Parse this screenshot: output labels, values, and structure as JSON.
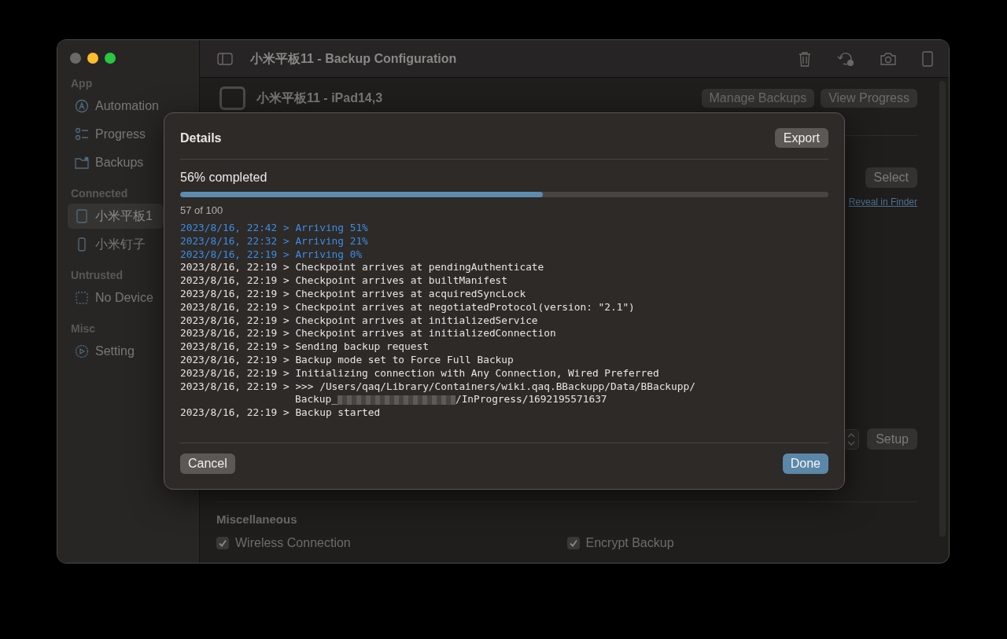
{
  "window": {
    "title": "小米平板11 - Backup Configuration"
  },
  "sidebar": {
    "sections": [
      {
        "title": "App",
        "items": [
          {
            "label": "Automation",
            "kind": "automation",
            "selected": false
          },
          {
            "label": "Progress",
            "kind": "progress",
            "selected": false
          },
          {
            "label": "Backups",
            "kind": "backups",
            "selected": false
          }
        ]
      },
      {
        "title": "Connected",
        "items": [
          {
            "label": "小米平板1",
            "kind": "tablet",
            "selected": true
          },
          {
            "label": "小米钉子",
            "kind": "phone",
            "selected": false
          }
        ]
      },
      {
        "title": "Untrusted",
        "items": [
          {
            "label": "No Device",
            "kind": "empty",
            "selected": false
          }
        ]
      },
      {
        "title": "Misc",
        "items": [
          {
            "label": "Setting",
            "kind": "gear",
            "selected": false
          }
        ]
      }
    ]
  },
  "device": {
    "name": "小米平板11 - iPad14,3",
    "buttons": [
      "Manage Backups",
      "View Progress"
    ]
  },
  "select_button": "Select",
  "reveal_link": "Reveal in Finder",
  "setup_button": "Setup",
  "miscellaneous": {
    "title": "Miscellaneous",
    "options": [
      {
        "label": "Wireless Connection",
        "checked": true
      },
      {
        "label": "Encrypt Backup",
        "checked": true
      }
    ]
  },
  "dialog": {
    "title": "Details",
    "export_button": "Export",
    "progress_text": "56% completed",
    "level": 0.56,
    "count": "57 of 100",
    "log": [
      {
        "kind": "progress",
        "time": "2023/8/16, 22:42",
        "prompt": ">",
        "message": "Arriving 51%"
      },
      {
        "kind": "progress",
        "time": "2023/8/16, 22:32",
        "prompt": ">",
        "message": "Arriving 21%"
      },
      {
        "kind": "progress",
        "time": "2023/8/16, 22:19",
        "prompt": ">",
        "message": "Arriving 0%"
      },
      {
        "kind": "event",
        "time": "2023/8/16, 22:19",
        "prompt": ">",
        "message": "Checkpoint arrives at pendingAuthenticate"
      },
      {
        "kind": "event",
        "time": "2023/8/16, 22:19",
        "prompt": ">",
        "message": "Checkpoint arrives at builtManifest"
      },
      {
        "kind": "event",
        "time": "2023/8/16, 22:19",
        "prompt": ">",
        "message": "Checkpoint arrives at acquiredSyncLock"
      },
      {
        "kind": "event",
        "time": "2023/8/16, 22:19",
        "prompt": ">",
        "message": "Checkpoint arrives at negotiatedProtocol(version: \"2.1\")"
      },
      {
        "kind": "event",
        "time": "2023/8/16, 22:19",
        "prompt": ">",
        "message": "Checkpoint arrives at initializedService"
      },
      {
        "kind": "event",
        "time": "2023/8/16, 22:19",
        "prompt": ">",
        "message": "Checkpoint arrives at initializedConnection"
      },
      {
        "kind": "event",
        "time": "2023/8/16, 22:19",
        "prompt": ">",
        "message": "Sending backup request"
      },
      {
        "kind": "event",
        "time": "2023/8/16, 22:19",
        "prompt": ">",
        "message": "Backup mode set to Force Full Backup"
      },
      {
        "kind": "event",
        "time": "2023/8/16, 22:19",
        "prompt": ">",
        "message": "Initializing connection with Any Connection, Wired Preferred"
      },
      {
        "kind": "event",
        "time": "2023/8/16, 22:19",
        "prompt": ">",
        "message": ">>> /Users/qaq/Library/Containers/wiki.qaq.BBackupp/Data/BBackupp/",
        "continuation": {
          "before": "Backup_",
          "redacted": true,
          "after": "/InProgress/1692195571637"
        }
      },
      {
        "kind": "event",
        "time": "2023/8/16, 22:19",
        "prompt": ">",
        "message": "Backup started"
      }
    ],
    "cancel_button": "Cancel",
    "done_button": "Done"
  }
}
